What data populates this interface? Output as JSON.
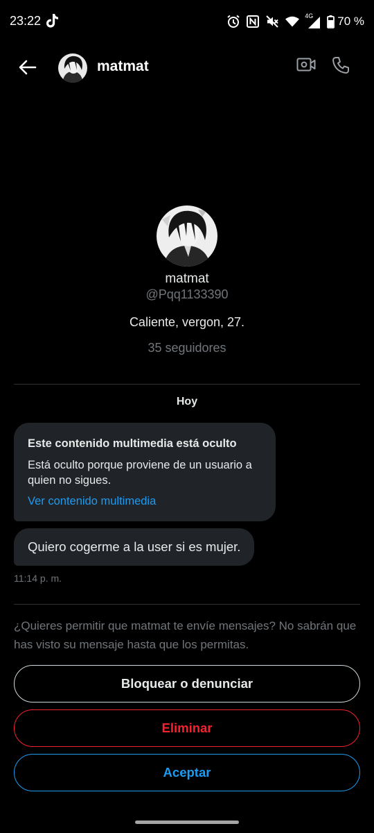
{
  "status_bar": {
    "time": "23:22",
    "network": "4G",
    "battery": "70 %"
  },
  "header": {
    "name": "matmat"
  },
  "profile": {
    "name": "matmat",
    "handle": "@Pqq1133390",
    "bio": "Caliente, vergon, 27.",
    "followers": "35 seguidores"
  },
  "conversation": {
    "date_label": "Hoy",
    "hidden_media": {
      "title": "Este contenido multimedia está oculto",
      "description": "Está oculto porque proviene de un usuario a quien no sigues.",
      "link": "Ver contenido multimedia"
    },
    "message": "Quiero cogerme a la user si es mujer.",
    "time": "11:14 p. m."
  },
  "request": {
    "text": "¿Quieres permitir que matmat te envíe mensajes? No sabrán que has visto su mensaje hasta que los permitas.",
    "block_label": "Bloquear o denunciar",
    "delete_label": "Eliminar",
    "accept_label": "Aceptar"
  },
  "colors": {
    "background": "#000000",
    "bubble": "#202327",
    "accent": "#1d9bf0",
    "danger": "#f4212e",
    "secondary_text": "#71767b"
  },
  "icons": [
    "tiktok-icon",
    "alarm-icon",
    "nfc-icon",
    "mute-icon",
    "wifi-icon",
    "signal-icon",
    "battery-icon",
    "back-arrow-icon",
    "video-camera-icon",
    "phone-icon"
  ]
}
